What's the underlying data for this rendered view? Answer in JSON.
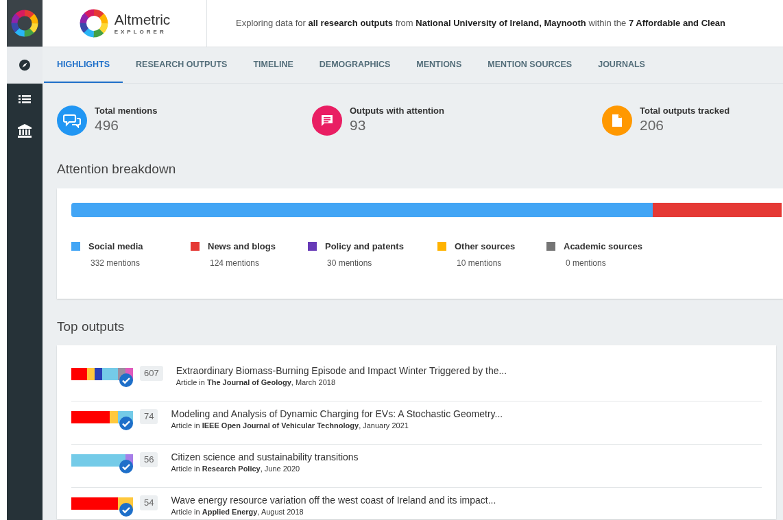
{
  "header": {
    "logo_title": "Altmetric",
    "logo_subtitle": "EXPLORER",
    "summary": "Exploring data for **all research outputs** from **National University of Ireland, Maynooth** within the **7 Affordable and Clean**"
  },
  "sidebar": {
    "items": [
      {
        "kind": "compass",
        "selected": true
      },
      {
        "kind": "list",
        "selected": false
      },
      {
        "kind": "institution",
        "selected": false
      }
    ]
  },
  "tabs": [
    {
      "label": "HIGHLIGHTS",
      "selected": true
    },
    {
      "label": "RESEARCH OUTPUTS",
      "selected": false
    },
    {
      "label": "TIMELINE",
      "selected": false
    },
    {
      "label": "DEMOGRAPHICS",
      "selected": false
    },
    {
      "label": "MENTIONS",
      "selected": false
    },
    {
      "label": "MENTION SOURCES",
      "selected": false
    },
    {
      "label": "JOURNALS",
      "selected": false
    }
  ],
  "stats": [
    {
      "kind": "mentions",
      "label": "Total mentions",
      "value": "496",
      "color": "#2196f3"
    },
    {
      "kind": "attention",
      "label": "Outputs with attention",
      "value": "93",
      "color": "#e91e63"
    },
    {
      "kind": "tracked",
      "label": "Total outputs tracked",
      "value": "206",
      "color": "#ff9800"
    }
  ],
  "attention_breakdown": {
    "title": "Attention breakdown",
    "sources": [
      {
        "label": "Social media",
        "count": "332 mentions",
        "color": "#42a5f5"
      },
      {
        "label": "News and blogs",
        "count": "124 mentions",
        "color": "#e53935"
      },
      {
        "label": "Policy and patents",
        "count": "30 mentions",
        "color": "#673ab7"
      },
      {
        "label": "Other sources",
        "count": "10 mentions",
        "color": "#ffb300"
      },
      {
        "label": "Academic sources",
        "count": "0 mentions",
        "color": "#757575"
      }
    ],
    "bar_segments": [
      {
        "color": "#42a5f5"
      },
      {
        "color": "#42a5f5"
      },
      {
        "color": "#42a5f5"
      },
      {
        "color": "#42a5f5"
      },
      {
        "color": "#42a5f5"
      },
      {
        "color": "#42a5f5"
      },
      {
        "color": "#42a5f5"
      },
      {
        "color": "#42a5f5"
      },
      {
        "color": "#42a5f5"
      },
      {
        "color": "#e53935"
      },
      {
        "color": "#e53935"
      }
    ]
  },
  "top_outputs": {
    "title": "Top outputs",
    "rows": [
      {
        "score": "607",
        "title": "Extraordinary Biomass-Burning Episode and Impact Winter Triggered by the...",
        "meta": "Article in **The Journal of Geology**, March 2018",
        "segments": [
          {
            "color": "#ff0000"
          },
          {
            "color": "#ff0000"
          },
          {
            "color": "#ffc83d"
          },
          {
            "color": "#2a40b8"
          },
          {
            "color": "#74cbe8"
          },
          {
            "color": "#74cbe8"
          },
          {
            "color": "#9b8fa0"
          },
          {
            "color": "#e05bbd"
          }
        ]
      },
      {
        "score": "74",
        "title": "Modeling and Analysis of Dynamic Charging for EVs: A Stochastic Geometry...",
        "meta": "Article in **IEEE Open Journal of Vehicular Technology**, January 2021",
        "segments": [
          {
            "color": "#ff0000"
          },
          {
            "color": "#ff0000"
          },
          {
            "color": "#ff0000"
          },
          {
            "color": "#ff0000"
          },
          {
            "color": "#ff0000"
          },
          {
            "color": "#ffc83d"
          },
          {
            "color": "#74cbe8"
          },
          {
            "color": "#74cbe8"
          }
        ]
      },
      {
        "score": "56",
        "title": "Citizen science and sustainability transitions",
        "meta": "Article in **Research Policy**, June 2020",
        "segments": [
          {
            "color": "#74cbe8"
          },
          {
            "color": "#74cbe8"
          },
          {
            "color": "#74cbe8"
          },
          {
            "color": "#74cbe8"
          },
          {
            "color": "#74cbe8"
          },
          {
            "color": "#74cbe8"
          },
          {
            "color": "#74cbe8"
          },
          {
            "color": "#a77ee8"
          }
        ]
      },
      {
        "score": "54",
        "title": "Wave energy resource variation off the west coast of Ireland and its impact...",
        "meta": "Article in **Applied Energy**, August 2018",
        "segments": [
          {
            "color": "#ff0000"
          },
          {
            "color": "#ff0000"
          },
          {
            "color": "#ff0000"
          },
          {
            "color": "#ff0000"
          },
          {
            "color": "#ff0000"
          },
          {
            "color": "#ff0000"
          },
          {
            "color": "#ffc83d"
          },
          {
            "color": "#ffc83d"
          }
        ]
      }
    ]
  }
}
